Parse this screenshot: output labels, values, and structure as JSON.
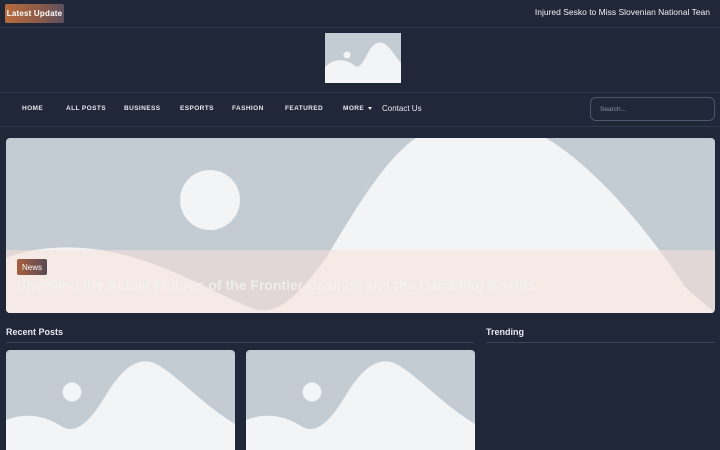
{
  "topbar": {
    "latest_label": "Latest  Update",
    "ticker_text": "Injured Sesko to Miss Slovenian National Tean"
  },
  "nav": {
    "items": [
      "HOME",
      "ALL POSTS",
      "BUSINESS",
      "ESPORTS",
      "FASHION",
      "FEATURED",
      "MORE"
    ],
    "contact": "Contact Us",
    "search_placeholder": "Search..."
  },
  "hero": {
    "tag": "News",
    "title": "Unveiling the Actual Figures of the Frontier Casinos and the Gambling Boards"
  },
  "sections": {
    "recent": "Recent Posts",
    "trending": "Trending"
  },
  "colors": {
    "background": "#1f2738",
    "accent": "#b86a3a",
    "placeholder_bg": "#c3cbd3",
    "placeholder_fg": "#f2f4f6"
  }
}
